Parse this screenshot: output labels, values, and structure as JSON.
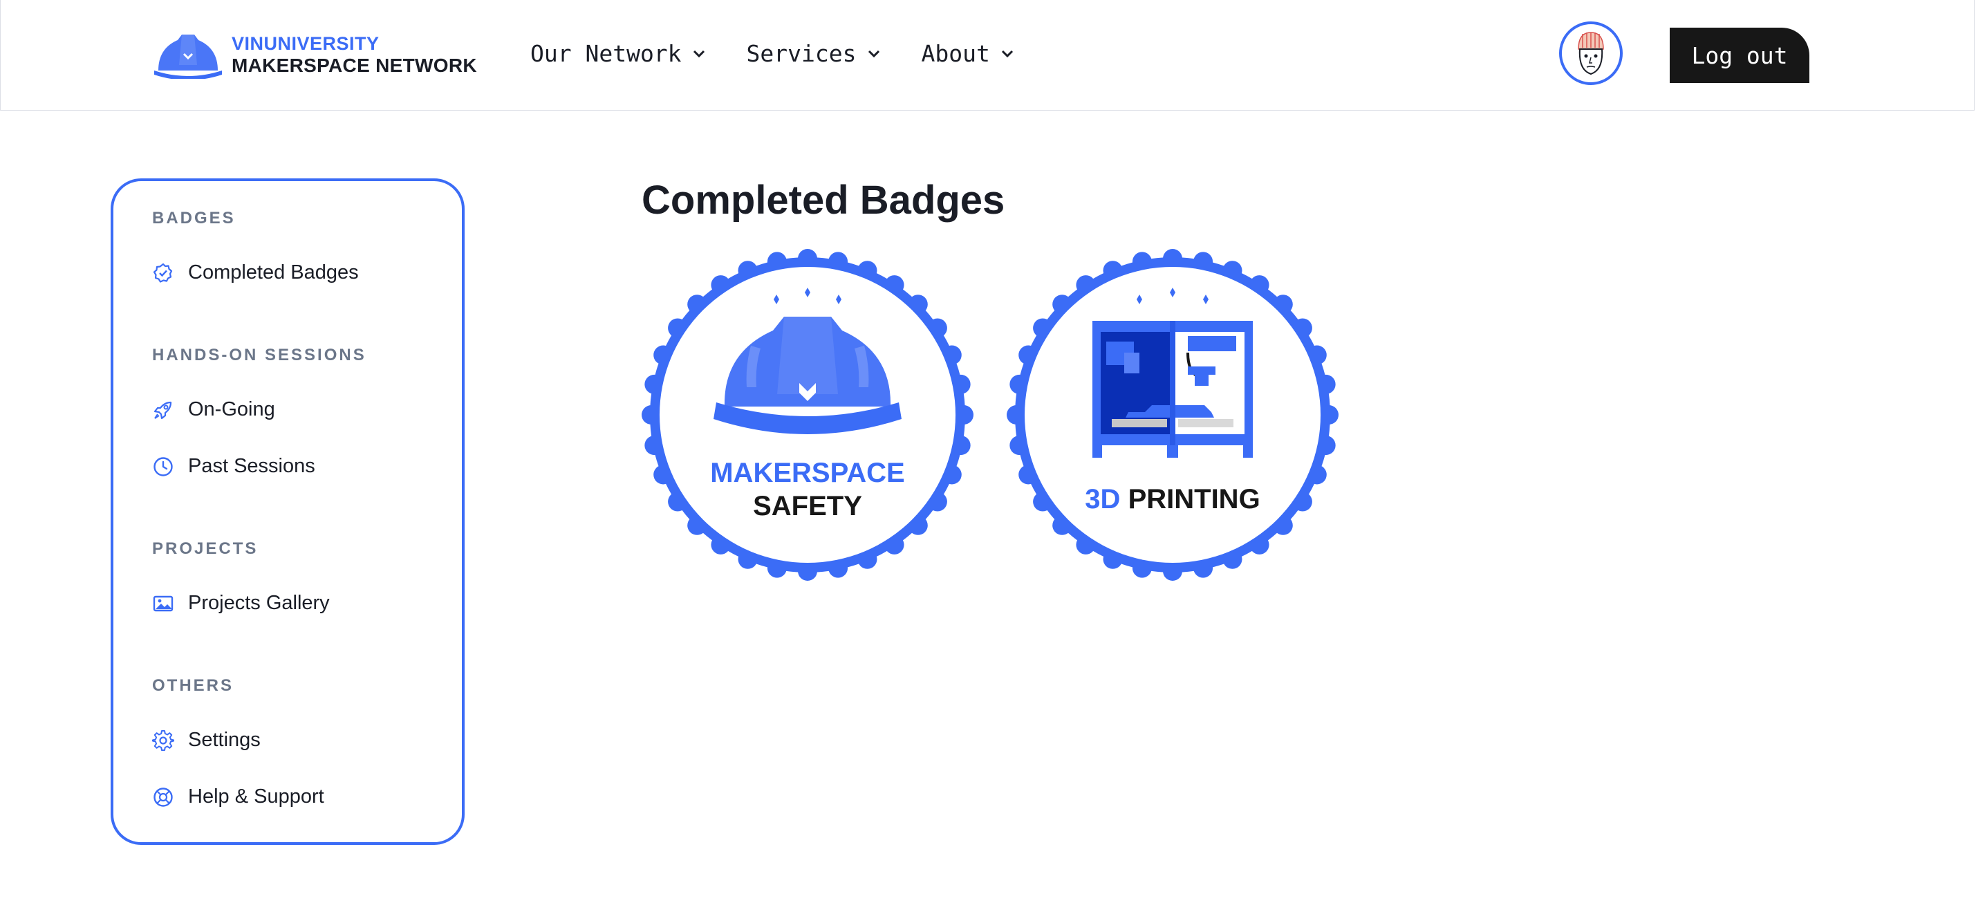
{
  "header": {
    "logo": {
      "line1": "VINUNIVERSITY",
      "line2": "MAKERSPACE NETWORK",
      "icon": "hard-hat-icon"
    },
    "nav": [
      {
        "label": "Our Network",
        "icon": "chevron-down-icon"
      },
      {
        "label": "Services",
        "icon": "chevron-down-icon"
      },
      {
        "label": "About",
        "icon": "chevron-down-icon"
      }
    ],
    "logout_label": "Log out"
  },
  "sidebar": {
    "sections": [
      {
        "title": "BADGES",
        "items": [
          {
            "label": "Completed Badges",
            "icon": "badge-check-icon"
          }
        ]
      },
      {
        "title": "HANDS-ON SESSIONS",
        "items": [
          {
            "label": "On-Going",
            "icon": "rocket-icon"
          },
          {
            "label": "Past Sessions",
            "icon": "clock-icon"
          }
        ]
      },
      {
        "title": "PROJECTS",
        "items": [
          {
            "label": "Projects Gallery",
            "icon": "image-icon"
          }
        ]
      },
      {
        "title": "OTHERS",
        "items": [
          {
            "label": "Settings",
            "icon": "gear-icon"
          },
          {
            "label": "Help & Support",
            "icon": "lifebuoy-icon"
          }
        ]
      }
    ]
  },
  "main": {
    "title": "Completed Badges",
    "badges": [
      {
        "line1": "MAKERSPACE",
        "line2": "SAFETY",
        "icon": "hard-hat-icon"
      },
      {
        "line1": "3D",
        "line2": "PRINTING",
        "icon": "3d-printer-icon"
      }
    ]
  },
  "colors": {
    "accent": "#3b6cf6",
    "dark": "#171717",
    "muted": "#6b7689"
  }
}
